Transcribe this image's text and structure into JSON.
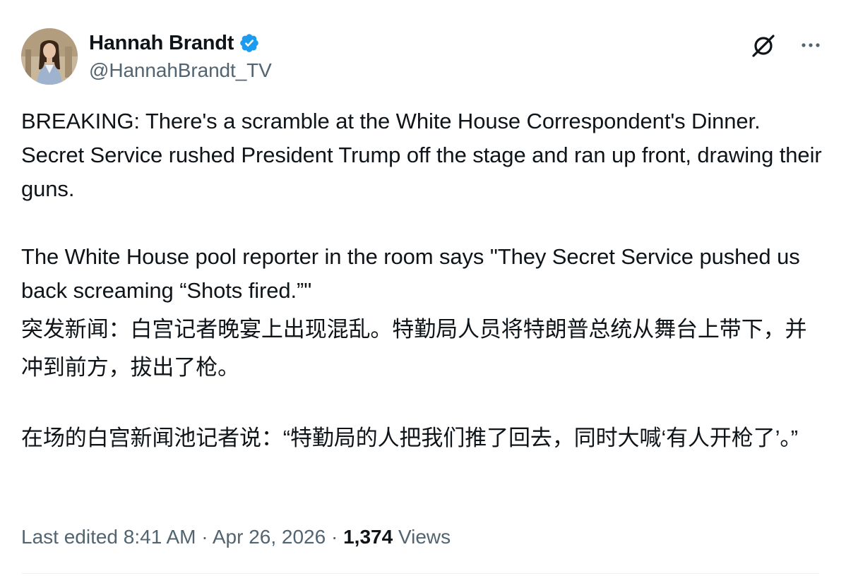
{
  "author": {
    "display_name": "Hannah Brandt",
    "handle": "@HannahBrandt_TV",
    "verified": true,
    "verified_color": "#1d9bf0"
  },
  "header_icons": {
    "grok": "grok-icon",
    "more": "more-horizontal-icon"
  },
  "tweet": {
    "en_paragraph_1": "BREAKING: There's a scramble at the White House Correspondent's Dinner. Secret Service rushed President Trump off the stage and ran up front, drawing their guns.",
    "en_paragraph_2": "The White House pool reporter in the room says \"They Secret Service pushed us back screaming “Shots fired.”\"",
    "zh_paragraph_1": "突发新闻：白宫记者晚宴上出现混乱。特勤局人员将特朗普总统从舞台上带下，并冲到前方，拔出了枪。",
    "zh_paragraph_2": "在场的白宫新闻池记者说：“特勤局的人把我们推了回去，同时大喊‘有人开枪了’。”"
  },
  "meta": {
    "edited_label": "Last edited 8:41 AM",
    "separator": " · ",
    "date": "Apr 26, 2026",
    "views_count": "1,374",
    "views_label": "Views"
  },
  "colors": {
    "text_primary": "#0f1419",
    "text_secondary": "#536471",
    "divider": "#eff3f4"
  }
}
